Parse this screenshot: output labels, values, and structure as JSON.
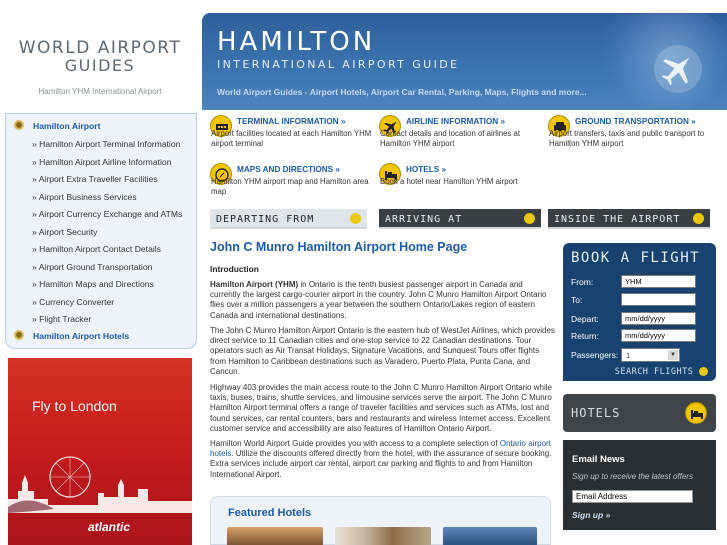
{
  "logo": {
    "line1": "WORLD AIRPORT",
    "line2": "GUIDES",
    "subtitle": "Hamilton YHM International Airport"
  },
  "header": {
    "title": "HAMILTON",
    "subtitle": "INTERNATIONAL AIRPORT GUIDE",
    "tagline": "World Airport Guides - Airport Hotels, Airport Car Rental, Parking, Maps, Flights and more..."
  },
  "nav": [
    {
      "label": "Hamilton Airport",
      "main": true
    },
    {
      "label": "» Hamilton Airport Terminal Information"
    },
    {
      "label": "» Hamilton Airport Airline Information"
    },
    {
      "label": "» Airport Extra Traveller Facilities"
    },
    {
      "label": "» Airport Business Services"
    },
    {
      "label": "» Airport Currency Exchange and ATMs"
    },
    {
      "label": "» Airport Security"
    },
    {
      "label": "» Hamilton Airport Contact Details"
    },
    {
      "label": "» Airport Ground Transportation"
    },
    {
      "label": "» Hamilton Maps and Directions"
    },
    {
      "label": "» Currency Converter"
    },
    {
      "label": "» Flight Tracker"
    },
    {
      "label": "Hamilton Airport Hotels",
      "main": true
    }
  ],
  "ad": {
    "text": "Fly to London",
    "brand": "atlantic"
  },
  "categories": [
    {
      "title": "TERMINAL INFORMATION »",
      "desc": "Airport facilities located at each Hamilton YHM airport terminal",
      "icon": "terminal-icon"
    },
    {
      "title": "AIRLINE INFORMATION »",
      "desc": "Contact details and location of airlines at Hamilton YHM airport",
      "icon": "plane-icon"
    },
    {
      "title": "GROUND TRANSPORTATION »",
      "desc": "Airport transfers, taxis and public transport to Hamilton YHM airport",
      "icon": "car-icon"
    },
    {
      "title": "MAPS AND DIRECTIONS »",
      "desc": "Hamilton YHM airport map and Hamilton area map",
      "icon": "compass-icon"
    },
    {
      "title": "HOTELS »",
      "desc": "Book a hotel near Hamilton YHM airport",
      "icon": "bed-icon"
    }
  ],
  "strips": [
    "DEPARTING FROM",
    "ARRIVING AT",
    "INSIDE THE AIRPORT"
  ],
  "article": {
    "title": "John C Munro Hamilton Airport Home Page",
    "intro_heading": "Introduction",
    "p1_bold": "Hamilton Airport (YHM)",
    "p1": " in Ontario is the tenth busiest passenger airport in Canada and currently the largest cargo-courier airport in the country. John C Munro Hamilton Airport Ontario flies over a million passengers a year between the southern Ontario/Lakes region of eastern Canada and international destinations.",
    "p2": "The John C Munro Hamilton Airport Ontario is the eastern hub of WestJet Airlines, which provides direct service to 11 Canadian cities and one-stop service to 22 Canadian destinations. Tour operators such as Air Transat Holidays, Signature Vacations, and Sunquest Tours offer flights from Hamilton to Caribbean destinations such as Varadero, Puerto Plata, Punta Cana, and Cancun.",
    "p3": "Highway 403 provides the main access route to the John C Munro Hamilton Airport Ontario while taxis, buses, trains, shuttle services, and limousine services serve the airport. The John C Munro Hamilton Airport terminal offers a range of traveler facilities and services such as ATMs, lost and found services, car rental counters, bars and restaurants and wireless Internet access. Excellent customer service and accessibility are also features of Hamilton Ontario Airport.",
    "p4a": "Hamilton World Airport Guide provides you with access to a complete selection of ",
    "p4link": "Ontario airport hotels",
    "p4b": ". Utilize the discounts offered directly from the hotel, with the assurance of secure booking. Extra services include airport car rental, airport car parking and flights to and from Hamilton International Airport."
  },
  "featured": {
    "title": "Featured Hotels"
  },
  "booking": {
    "title": "BOOK A FLIGHT",
    "from_label": "From:",
    "from_value": "YHM",
    "to_label": "To:",
    "to_value": "",
    "depart_label": "Depart:",
    "depart_value": "mm/dd/yyyy",
    "return_label": "Return:",
    "return_value": "mm/dd/yyyy",
    "pass_label": "Passengers:",
    "pass_value": "1",
    "search_label": "SEARCH FLIGHTS"
  },
  "hotels_widget": {
    "title": "HOTELS"
  },
  "email": {
    "title": "Email News",
    "desc": "Sign up to receive the latest offers",
    "placeholder": "Email Address",
    "signup": "Sign up »"
  },
  "colors": {
    "accent": "#1a5ca8",
    "header": "#3b73b0",
    "yellow": "#f3c400",
    "dark": "#3a3f43",
    "book": "#18426f"
  }
}
